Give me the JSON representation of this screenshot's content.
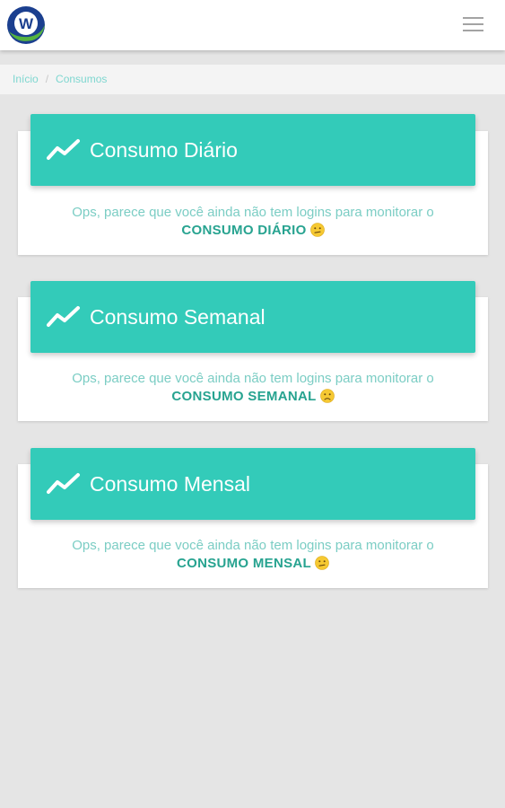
{
  "header": {
    "logo_letter": "W",
    "menu_icon": "hamburger-menu-icon"
  },
  "breadcrumb": {
    "items": [
      "Início",
      "Consumos"
    ],
    "separator": "/"
  },
  "cards": [
    {
      "title": "Consumo Diário",
      "message": "Ops, parece que você ainda não tem logins para monitorar o",
      "highlight": "CONSUMO DIÁRIO",
      "icon": "trending-up-icon",
      "emoji": "confused-face-emoji"
    },
    {
      "title": "Consumo Semanal",
      "message": "Ops, parece que você ainda não tem logins para monitorar o",
      "highlight": "CONSUMO SEMANAL",
      "icon": "trending-up-icon",
      "emoji": "frowning-face-emoji"
    },
    {
      "title": "Consumo Mensal",
      "message": "Ops, parece que você ainda não tem logins para monitorar o",
      "highlight": "CONSUMO MENSAL",
      "icon": "trending-up-icon",
      "emoji": "confused-face-emoji"
    }
  ],
  "colors": {
    "accent": "#33cbb9",
    "accent_dark": "#27a390",
    "message_text": "#7bcdc4",
    "page_bg": "#e5e5e5"
  }
}
